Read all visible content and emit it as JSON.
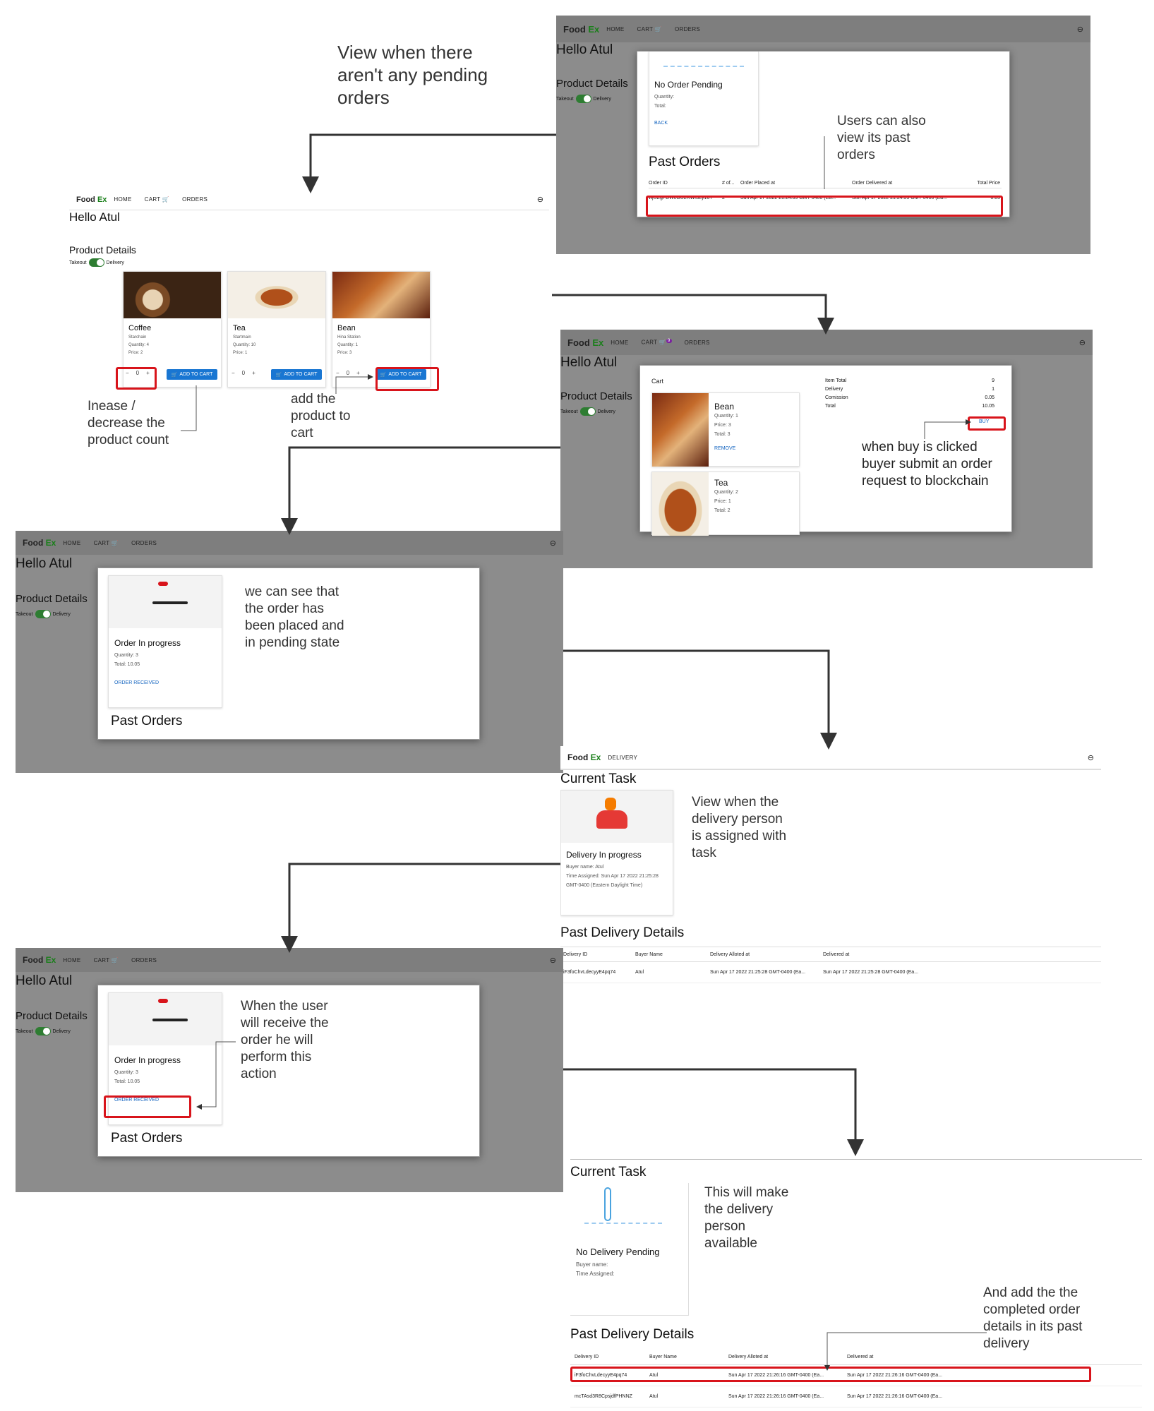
{
  "app": {
    "logo1": "Food",
    "logo2": "Ex",
    "home": "HOME",
    "cart": "CART",
    "orders": "ORDERS",
    "delivery": "DELIVERY",
    "hello": "Hello Atul",
    "product_details": "Product Details",
    "takeout": "Takeout",
    "delivery_toggle": "Delivery",
    "add_to_cart": "ADD TO CART",
    "cart_badge": "9"
  },
  "notes": {
    "no_pending": "View when there aren't any pending orders",
    "past_orders": "Users can also view its past orders",
    "count": "Inease / decrease the product count",
    "add": "add the product to cart",
    "buy": "when buy is clicked buyer submit an order request to blockchain",
    "pending": "we can see that the order has been placed and in pending state",
    "assigned": "View when the delivery person is assigned with task",
    "receive": "When the user will receive the order he will perform this action",
    "available": "This will make the delivery person available",
    "completed": "And add the the completed order details in its past delivery"
  },
  "products": [
    {
      "name": "Coffee",
      "seller": "Starchain",
      "quantity": "Quantity: 4",
      "price": "Price: 2"
    },
    {
      "name": "Tea",
      "seller": "Startmain",
      "quantity": "Quantity: 10",
      "price": "Price: 1"
    },
    {
      "name": "Bean",
      "seller": "Hina Station",
      "quantity": "Quantity: 1",
      "price": "Price: 3"
    }
  ],
  "stepper": {
    "minus": "−",
    "value": "0",
    "plus": "+"
  },
  "no_order": {
    "title": "No Order Pending",
    "quantity": "Quantity:",
    "total": "Total:",
    "back": "BACK"
  },
  "past_orders": {
    "title": "Past Orders",
    "headers": [
      "Order ID",
      "# of...",
      "Order Placed at",
      "Order Delivered at",
      "Total Price"
    ],
    "row": [
      "wjUZgFDWcGU2RWiSLy16T",
      "2",
      "Sun Apr 17 2022 21:24:39 GMT-0400 (Ea...",
      "Sun Apr 17 2022 21:24:39 GMT-0400 (Ea...",
      "6.05"
    ]
  },
  "cart": {
    "title": "Cart",
    "items": [
      {
        "name": "Bean",
        "quantity": "Quantity: 1",
        "price": "Price: 3",
        "total": "Total: 3",
        "remove": "REMOVE"
      },
      {
        "name": "Tea",
        "quantity": "Quantity: 2",
        "price": "Price: 1",
        "total": "Total: 2"
      }
    ],
    "summary_labels": [
      "Item Total",
      "Delivery",
      "Comission",
      "Total"
    ],
    "summary_values": [
      "9",
      "1",
      "0.05",
      "10.05"
    ],
    "buy": "BUY"
  },
  "order_progress": {
    "title": "Order In progress",
    "quantity": "Quantity: 3",
    "total": "Total: 10.05",
    "received": "ORDER RECEIVED",
    "past_orders": "Past Orders"
  },
  "delivery_task": {
    "current_task": "Current Task",
    "title": "Delivery In progress",
    "buyer": "Buyer name: Atul",
    "time": "Time Assigned: Sun Apr 17 2022 21:25:28 GMT-0400 (Eastern Daylight Time)",
    "past_title": "Past Delivery Details",
    "headers": [
      "Delivery ID",
      "Buyer Name",
      "Delivery Alloted at",
      "Delivered at"
    ],
    "row": [
      "iF3foChvLdecyyE4pq74",
      "Atul",
      "Sun Apr 17 2022 21:25:28 GMT-0400 (Ea...",
      "Sun Apr 17 2022 21:25:28 GMT-0400 (Ea..."
    ]
  },
  "delivery_pending": {
    "current_task": "Current Task",
    "title": "No Delivery Pending",
    "buyer": "Buyer name:",
    "time": "Time Assigned:",
    "past_title": "Past Delivery Details",
    "headers": [
      "Delivery ID",
      "Buyer Name",
      "Delivery Alloted at",
      "Delivered at"
    ],
    "rows": [
      [
        "iF3foChvLdecyyE4pq74",
        "Atul",
        "Sun Apr 17 2022 21:26:16 GMT-0400 (Ea...",
        "Sun Apr 17 2022 21:26:16 GMT-0400 (Ea..."
      ],
      [
        "mcTAsd3R8CpsjdfPHNNZ",
        "Atul",
        "Sun Apr 17 2022 21:26:16 GMT-0400 (Ea...",
        "Sun Apr 17 2022 21:26:16 GMT-0400 (Ea..."
      ]
    ]
  },
  "colors": {
    "red_highlight": "#d8141b",
    "brand_green": "#1a7f1a",
    "button_blue": "#1976d2",
    "link_blue": "#1565c0"
  }
}
